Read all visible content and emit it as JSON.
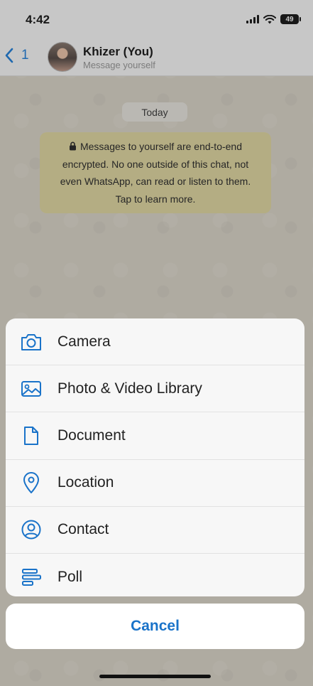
{
  "status_bar": {
    "time": "4:42",
    "battery": "49"
  },
  "header": {
    "back_count": "1",
    "contact_name": "Khizer (You)",
    "contact_subtitle": "Message yourself"
  },
  "chat": {
    "date_label": "Today",
    "encryption_notice": {
      "line1": "Messages to yourself are end-to-end",
      "line2": "encrypted. No one outside of this chat, not",
      "line3": "even WhatsApp, can read or listen to them.",
      "line4": "Tap to learn more."
    }
  },
  "action_sheet": {
    "items": [
      {
        "label": "Camera",
        "icon": "camera-icon"
      },
      {
        "label": "Photo & Video Library",
        "icon": "image-icon"
      },
      {
        "label": "Document",
        "icon": "document-icon"
      },
      {
        "label": "Location",
        "icon": "location-pin-icon"
      },
      {
        "label": "Contact",
        "icon": "contact-icon"
      },
      {
        "label": "Poll",
        "icon": "poll-icon"
      }
    ],
    "cancel_label": "Cancel"
  },
  "colors": {
    "accent": "#1a73c9",
    "notice_bg": "#cfc693",
    "sheet_bg": "#f7f7f7"
  }
}
